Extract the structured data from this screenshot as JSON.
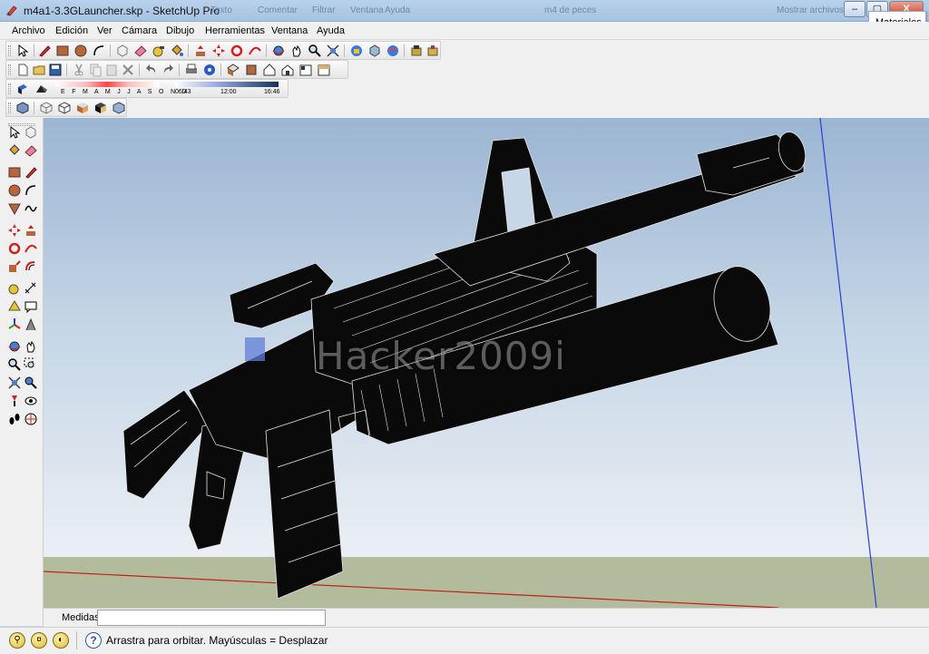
{
  "window": {
    "title": "m4a1-3.3GLauncher.skp - SketchUp Pro",
    "background_titles": [
      "Texto",
      "Comentar",
      "Filtrar",
      "Ventana",
      "Ayuda",
      "m4 de peces",
      "Mostrar archivos"
    ],
    "buttons": {
      "minimize": "–",
      "maximize": "▢",
      "close": "X"
    }
  },
  "materials_panel": {
    "title": "Materiales"
  },
  "menu": [
    {
      "label": "Archivo"
    },
    {
      "label": "Edición"
    },
    {
      "label": "Ver"
    },
    {
      "label": "Cámara"
    },
    {
      "label": "Dibujo"
    },
    {
      "label": "Herramientas"
    },
    {
      "label": "Ventana"
    },
    {
      "label": "Ayuda"
    }
  ],
  "shadows_toolbar": {
    "months": "E F M A M J J A S O N D",
    "time_start": "06:43",
    "time_mid": "12:00",
    "time_end": "16:46"
  },
  "viewport": {
    "watermark": "Hacker2009i"
  },
  "measurements": {
    "label": "Medidas",
    "value": ""
  },
  "status": {
    "message": "Arrastra para orbitar.  Mayúsculas = Desplazar"
  },
  "colors": {
    "sky_top": "#9bb5d3",
    "ground": "#b2bc9c",
    "axis_red": "#c0201a",
    "axis_blue": "#2a3fd0",
    "model": "#0a0a0a"
  }
}
